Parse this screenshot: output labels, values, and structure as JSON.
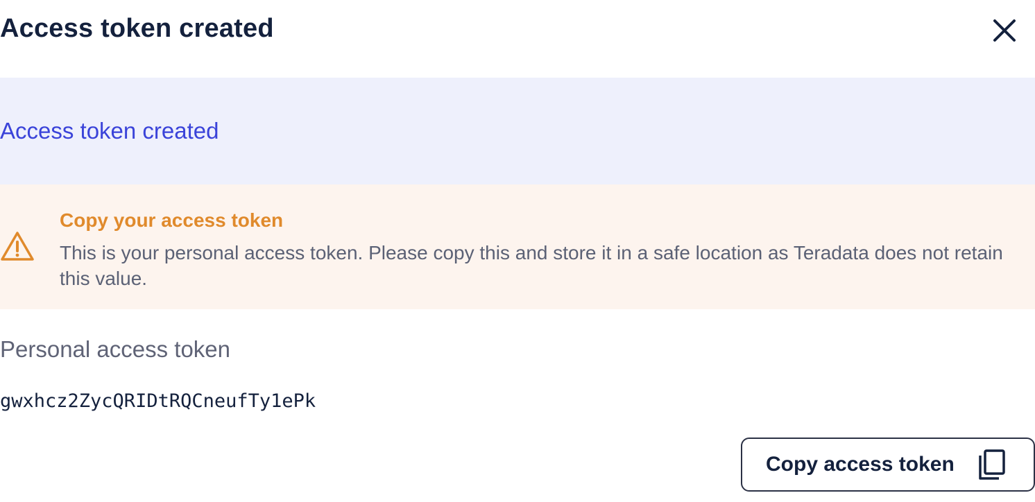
{
  "dialog": {
    "title": "Access token created",
    "close_icon": "close-icon"
  },
  "info_banner": {
    "text": "Access token created",
    "background": "#eef0fc",
    "text_color": "#3a43d9"
  },
  "warning_banner": {
    "icon": "warning-triangle-icon",
    "title": "Copy your access token",
    "body": "This is your personal access token. Please copy this and store it in a safe location as Teradata does not retain this value.",
    "background": "#fdf4ee",
    "accent_color": "#e08a2c"
  },
  "token": {
    "label": "Personal access token",
    "value": "gwxhcz2ZycQRIDtRQCneufTy1ePk"
  },
  "copy_button": {
    "label": "Copy access token",
    "icon": "copy-icon"
  }
}
